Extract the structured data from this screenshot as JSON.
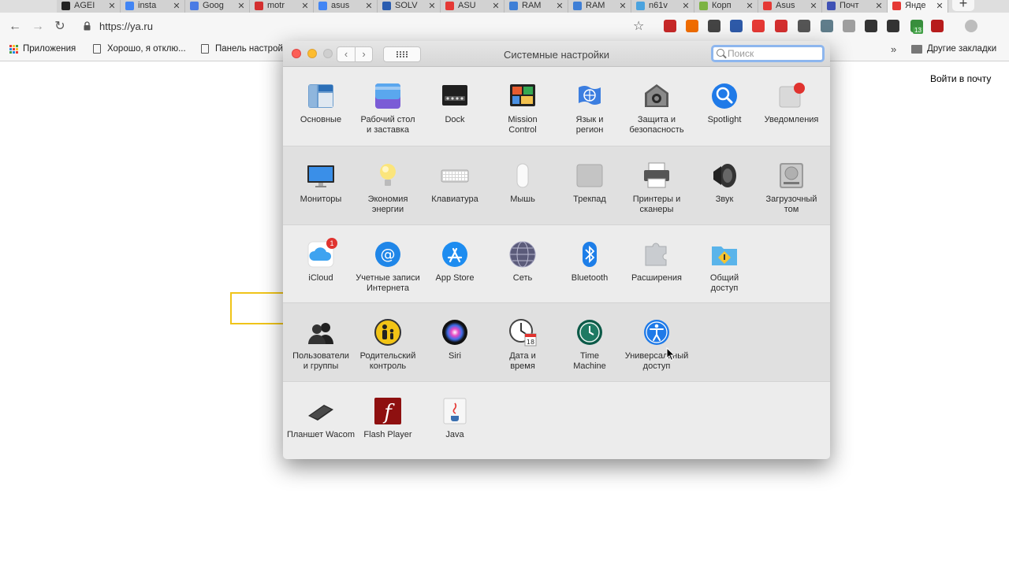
{
  "browser": {
    "tabs": [
      {
        "title": "AGEI",
        "color": "#222222"
      },
      {
        "title": "insta",
        "color": "#4285f4"
      },
      {
        "title": "Goog",
        "color": "#4a7be4"
      },
      {
        "title": "motr",
        "color": "#d32f2f"
      },
      {
        "title": "asus",
        "color": "#4285f4"
      },
      {
        "title": "SOLV",
        "color": "#2a5db0"
      },
      {
        "title": "ASU",
        "color": "#e53935"
      },
      {
        "title": "RAM",
        "color": "#3f7fd6"
      },
      {
        "title": "RAM",
        "color": "#3f7fd6"
      },
      {
        "title": "n61v",
        "color": "#4aa3df"
      },
      {
        "title": "Корп",
        "color": "#7cb342"
      },
      {
        "title": "Asus",
        "color": "#e53935"
      },
      {
        "title": "Почт",
        "color": "#3f51b5"
      },
      {
        "title": "Янде",
        "color": "#e53935"
      }
    ],
    "new_tab": "+",
    "url": "https://ya.ru",
    "back": "←",
    "forward": "→",
    "reload": "↻",
    "star": "☆",
    "bookmarks": [
      "Приложения",
      "Хорошо, я отклю...",
      "Панель настрой"
    ],
    "bookmarks_more": "»",
    "other_bookmarks": "Другие закладки",
    "ext_badge": "13"
  },
  "page": {
    "login_link": "Войти в почту"
  },
  "window": {
    "title": "Системные настройки",
    "search_placeholder": "Поиск",
    "back_arrow": "‹",
    "forward_arrow": "›",
    "rows": [
      [
        {
          "name": "general",
          "label": "Основные",
          "icon": "general-icon"
        },
        {
          "name": "desktop",
          "label": "Рабочий стол\nи заставка",
          "icon": "desktop-icon"
        },
        {
          "name": "dock",
          "label": "Dock",
          "icon": "dock-icon"
        },
        {
          "name": "mission-control",
          "label": "Mission\nControl",
          "icon": "mission-control-icon"
        },
        {
          "name": "language",
          "label": "Язык и\nрегион",
          "icon": "flag-icon"
        },
        {
          "name": "security",
          "label": "Защита и\nбезопасность",
          "icon": "house-icon"
        },
        {
          "name": "spotlight",
          "label": "Spotlight",
          "icon": "magnifier-icon"
        },
        {
          "name": "notifications",
          "label": "Уведомления",
          "icon": "notifications-icon"
        }
      ],
      [
        {
          "name": "displays",
          "label": "Мониторы",
          "icon": "monitor-icon"
        },
        {
          "name": "energy",
          "label": "Экономия\nэнергии",
          "icon": "lightbulb-icon"
        },
        {
          "name": "keyboard",
          "label": "Клавиатура",
          "icon": "keyboard-icon"
        },
        {
          "name": "mouse",
          "label": "Мышь",
          "icon": "mouse-icon"
        },
        {
          "name": "trackpad",
          "label": "Трекпад",
          "icon": "trackpad-icon"
        },
        {
          "name": "printers",
          "label": "Принтеры и\nсканеры",
          "icon": "printer-icon"
        },
        {
          "name": "sound",
          "label": "Звук",
          "icon": "speaker-icon"
        },
        {
          "name": "startup-disk",
          "label": "Загрузочный\nтом",
          "icon": "disk-icon"
        }
      ],
      [
        {
          "name": "icloud",
          "label": "iCloud",
          "icon": "cloud-icon",
          "badge": "1"
        },
        {
          "name": "internet-accounts",
          "label": "Учетные записи\nИнтернета",
          "icon": "at-icon"
        },
        {
          "name": "app-store",
          "label": "App Store",
          "icon": "app-store-icon"
        },
        {
          "name": "network",
          "label": "Сеть",
          "icon": "globe-icon"
        },
        {
          "name": "bluetooth",
          "label": "Bluetooth",
          "icon": "bluetooth-icon"
        },
        {
          "name": "extensions",
          "label": "Расширения",
          "icon": "puzzle-icon"
        },
        {
          "name": "sharing",
          "label": "Общий\nдоступ",
          "icon": "sharing-folder-icon"
        }
      ],
      [
        {
          "name": "users",
          "label": "Пользователи\nи группы",
          "icon": "users-icon"
        },
        {
          "name": "parental",
          "label": "Родительский\nконтроль",
          "icon": "parental-icon"
        },
        {
          "name": "siri",
          "label": "Siri",
          "icon": "siri-icon"
        },
        {
          "name": "date-time",
          "label": "Дата и\nвремя",
          "icon": "clock-icon",
          "calendar_day": "18"
        },
        {
          "name": "time-machine",
          "label": "Time\nMachine",
          "icon": "time-machine-icon"
        },
        {
          "name": "accessibility",
          "label": "Универсальный\nдоступ",
          "icon": "accessibility-icon"
        }
      ],
      [
        {
          "name": "wacom",
          "label": "Планшет Wacom",
          "icon": "tablet-icon"
        },
        {
          "name": "flash",
          "label": "Flash Player",
          "icon": "flash-icon",
          "glyph": "f"
        },
        {
          "name": "java",
          "label": "Java",
          "icon": "java-icon"
        }
      ]
    ]
  }
}
